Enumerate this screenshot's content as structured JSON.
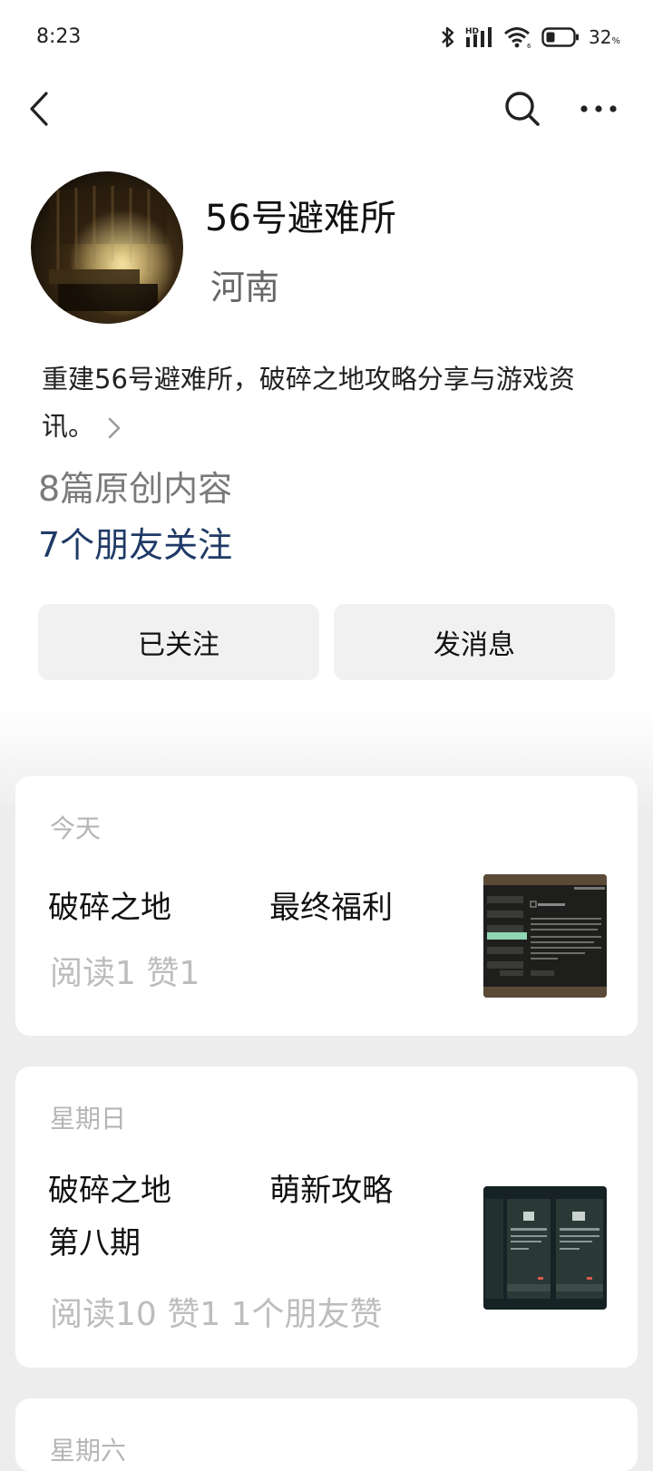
{
  "status_bar": {
    "time": "8:23",
    "battery_percent": "32",
    "battery_unit": "%",
    "icons": [
      "bluetooth-icon",
      "hd-signal-icon",
      "wifi-icon",
      "battery-icon"
    ]
  },
  "nav": {
    "icons": [
      "back-arrow-icon",
      "search-icon",
      "more-icon"
    ]
  },
  "profile": {
    "name": "56号避难所",
    "region": "河南",
    "bio": "重建56号避难所，破碎之地攻略分享与游戏资讯。",
    "article_count": "8篇原创内容",
    "friends_follow": "7个朋友关注"
  },
  "actions": {
    "follow_label": "已关注",
    "message_label": "发消息"
  },
  "articles": [
    {
      "date": "今天",
      "title": "破碎之地          最终福利",
      "stats": "阅读1  赞1"
    },
    {
      "date": "星期日",
      "title": "破碎之地          萌新攻略\n第八期",
      "stats": "阅读10  赞1  1个朋友赞"
    },
    {
      "date": "星期六"
    }
  ],
  "colors": {
    "background": "#ededed",
    "friends_link": "#1f3a66",
    "button_bg": "#f1f1f1"
  }
}
